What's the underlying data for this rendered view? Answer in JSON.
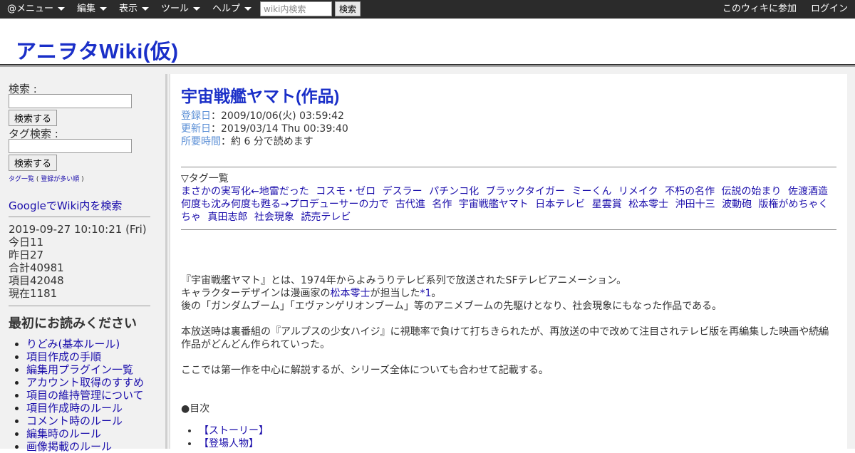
{
  "topbar": {
    "menus": [
      "@メニュー",
      "編集",
      "表示",
      "ツール",
      "ヘルプ"
    ],
    "search_placeholder": "wiki内検索",
    "search_button": "検索",
    "join": "このウィキに参加",
    "login": "ログイン"
  },
  "header": {
    "site_title": "アニヲタWiki(仮)"
  },
  "sidebar": {
    "search_label": "検索 :",
    "search_button": "検索する",
    "tag_search_label": "タグ検索 :",
    "tag_search_button": "検索する",
    "tag_list_link": "タグ一覧",
    "tag_list_paren_open": "(",
    "tag_popular_link": "登録が多い順",
    "tag_list_paren_close": ")",
    "google_search": "GoogleでWiki内を検索",
    "stats": {
      "datetime": "2019-09-27 10:10:21 (Fri)",
      "today": "今日11",
      "yesterday": "昨日27",
      "total": "合計40981",
      "items": "項目42048",
      "current": "現在1181"
    },
    "read_first_title": "最初にお読みください",
    "read_first_items": [
      "りどみ(基本ルール)",
      "項目作成の手順",
      "編集用プラグイン一覧",
      "アカウント取得のすすめ",
      "項目の維持管理について",
      "項目作成時のルール",
      "コメント時のルール",
      "編集時のルール",
      "画像掲載のルール"
    ]
  },
  "article": {
    "title": "宇宙戦艦ヤマト(作品)",
    "registered_label": "登録日",
    "registered_value": "：2009/10/06(火) 03:59:42",
    "updated_label": "更新日",
    "updated_value": "：2019/03/14 Thu 00:39:40",
    "reading_label": "所要時間",
    "reading_value": "：約 6 分で読めます",
    "tag_list_heading": "▽タグ一覧",
    "tags": [
      "まさかの実写化←地雷だった",
      "コスモ・ゼロ",
      "デスラー",
      "パチンコ化",
      "ブラックタイガー",
      "ミーくん",
      "リメイク",
      "不朽の名作",
      "伝説の始まり",
      "佐渡酒造",
      "何度も沈み何度も甦る→プロデューサーの力で",
      "古代進",
      "名作",
      "宇宙戦艦ヤマト",
      "日本テレビ",
      "星雲賞",
      "松本零士",
      "沖田十三",
      "波動砲",
      "版権がめちゃくちゃ",
      "真田志郎",
      "社会現象",
      "読売テレビ"
    ],
    "intro_1": "『宇宙戦艦ヤマト』とは、1974年からよみうりテレビ系列で放送されたSFテレビアニメーション。",
    "intro_2_prefix": "キャラクターデザインは漫画家の",
    "intro_2_link": "松本零士",
    "intro_2_mid": "が担当した",
    "intro_2_note": "*1",
    "intro_2_suffix": "。",
    "intro_3": "後の「ガンダムブーム」「エヴァンゲリオンブーム」等のアニメブームの先駆けとなり、社会現象にもなった作品である。",
    "para_2": "本放送時は裏番組の『アルプスの少女ハイジ』に視聴率で負けて打ちきられたが、再放送の中で改めて注目されテレビ版を再編集した映画や続編作品がどんどん作られていった。",
    "para_3": "ここでは第一作を中心に解説するが、シリーズ全体についても合わせて記載する。",
    "toc_heading": "●目次",
    "toc": [
      "【ストーリー】",
      "【登場人物】"
    ]
  }
}
